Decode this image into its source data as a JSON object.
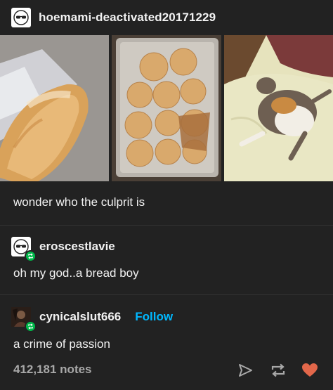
{
  "post": {
    "author": "hoemami-deactivated20171229",
    "caption": "wonder who the culprit is"
  },
  "reblogs": [
    {
      "name": "eroscestlavie",
      "text": "oh my god..a bread boy"
    },
    {
      "name": "cynicalslut666",
      "follow_label": "Follow",
      "text": "a crime of passion"
    }
  ],
  "footer": {
    "notes": "412,181 notes",
    "icons": [
      "share-icon",
      "reblog-icon",
      "heart-icon"
    ]
  },
  "colors": {
    "background": "#222222",
    "text": "#f2f2f2",
    "muted": "#a8a8a8",
    "follow": "#00b8ff",
    "reblog_badge": "#00b94a",
    "heart": "#e2674a"
  }
}
